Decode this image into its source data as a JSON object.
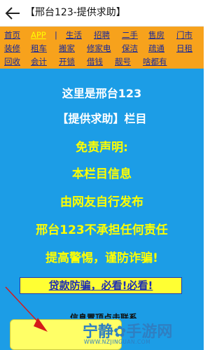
{
  "header": {
    "back_icon": "back-arrow-icon",
    "title": "【邢台123-提供求助】"
  },
  "nav": {
    "rows": [
      [
        {
          "label": "首页",
          "active": false
        },
        {
          "label": "APP",
          "active": true
        },
        {
          "label": "|",
          "sep": true
        },
        {
          "label": "生活"
        },
        {
          "label": "招聘"
        },
        {
          "label": "二手"
        },
        {
          "label": "售房"
        },
        {
          "label": "门市"
        }
      ],
      [
        {
          "label": "装修"
        },
        {
          "label": "租车"
        },
        {
          "label": "搬家"
        },
        {
          "label": "修家电"
        },
        {
          "label": "保洁"
        },
        {
          "label": "疏通"
        },
        {
          "label": "日租"
        }
      ],
      [
        {
          "label": "回收"
        },
        {
          "label": "会计"
        },
        {
          "label": "开锁"
        },
        {
          "label": "借钱"
        },
        {
          "label": "靓号"
        },
        {
          "label": "啥都有"
        }
      ]
    ]
  },
  "main": {
    "lines": [
      "这里是邢台123",
      "【提供求助】栏目",
      "免责声明:",
      "本栏目信息",
      "由网友自行发布",
      "邢台123不承担任何责任",
      "提高警惕，谨防诈骗!"
    ],
    "banner": "贷款防骗，必看!必看!",
    "partial_text": "信息置顶点击联系"
  },
  "watermark": {
    "text": "宁静✿手游网",
    "url": "WWW.NZJINGUAN.COM"
  },
  "colors": {
    "nav_bg": "#f7a21c",
    "main_bg": "#1c9de6",
    "link": "#1b2a9a",
    "highlight": "#ffff00"
  }
}
